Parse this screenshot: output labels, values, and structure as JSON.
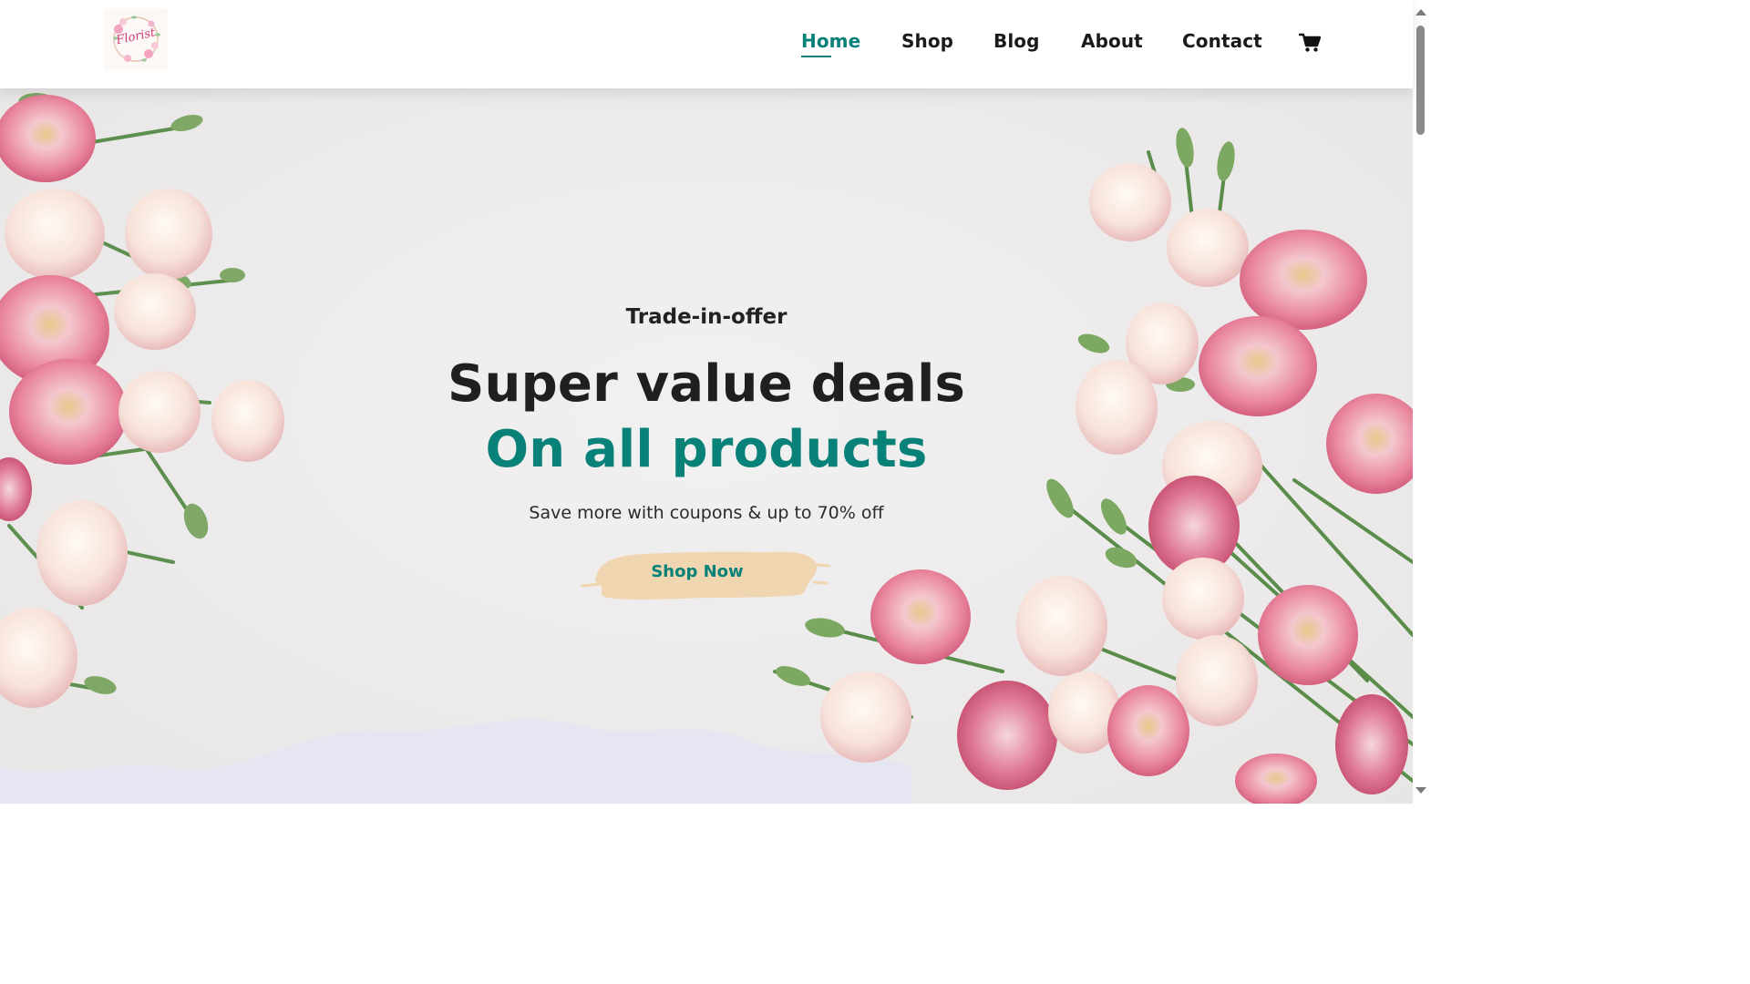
{
  "logo": {
    "text": "Florist"
  },
  "nav": {
    "items": [
      {
        "label": "Home",
        "active": true
      },
      {
        "label": "Shop",
        "active": false
      },
      {
        "label": "Blog",
        "active": false
      },
      {
        "label": "About",
        "active": false
      },
      {
        "label": "Contact",
        "active": false
      }
    ],
    "cart_icon": "shopping-cart-icon"
  },
  "hero": {
    "tag": "Trade-in-offer",
    "title": "Super value deals",
    "subtitle": "On all products",
    "description": "Save more with coupons & up to 70% off",
    "cta_label": "Shop Now"
  },
  "colors": {
    "accent": "#088178",
    "cta_brush": "#f0d6b0",
    "text_dark": "#222222"
  }
}
